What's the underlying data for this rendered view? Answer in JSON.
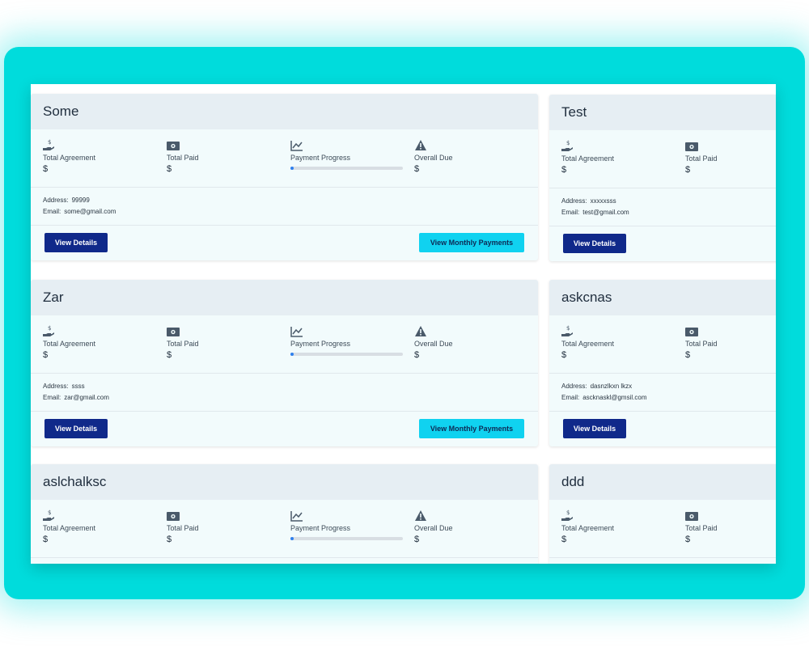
{
  "colors": {
    "frame": "#00dcdc",
    "card_header": "#e6eef3",
    "card_body": "#f2fbfc",
    "primary_button": "#10298a",
    "secondary_button": "#10d2f0",
    "progress_fill": "#2f80ed"
  },
  "labels": {
    "total_agreement": "Total Agreement",
    "total_paid": "Total Paid",
    "payment_progress": "Payment Progress",
    "overall_due": "Overall Due",
    "address": "Address:",
    "email": "Email:",
    "view_details": "View Details",
    "view_monthly": "View Monthly Payments"
  },
  "icons": {
    "total_agreement": "hand-dollar-icon",
    "total_paid": "money-bill-icon",
    "payment_progress": "chart-line-icon",
    "overall_due": "warning-icon"
  },
  "clients": [
    {
      "name": "Some",
      "total_agreement": "$",
      "total_paid": "$",
      "payment_progress": 0.03,
      "overall_due": "$",
      "address": "99999",
      "email": "some@gmail.com"
    },
    {
      "name": "Test",
      "total_agreement": "$",
      "total_paid": "$",
      "address": "xxxxxsss",
      "email": "test@gmail.com"
    },
    {
      "name": "Zar",
      "total_agreement": "$",
      "total_paid": "$",
      "payment_progress": 0.03,
      "overall_due": "$",
      "address": "ssss",
      "email": "zar@gmail.com"
    },
    {
      "name": "askcnas",
      "total_agreement": "$",
      "total_paid": "$",
      "address": "dasnzlkxn lkzx",
      "email": "ascknaskl@gmsil.com"
    },
    {
      "name": "aslchalksc",
      "total_agreement": "$",
      "total_paid": "$",
      "payment_progress": 0.03,
      "overall_due": "$"
    },
    {
      "name": "ddd",
      "total_agreement": "$",
      "total_paid": "$"
    }
  ]
}
